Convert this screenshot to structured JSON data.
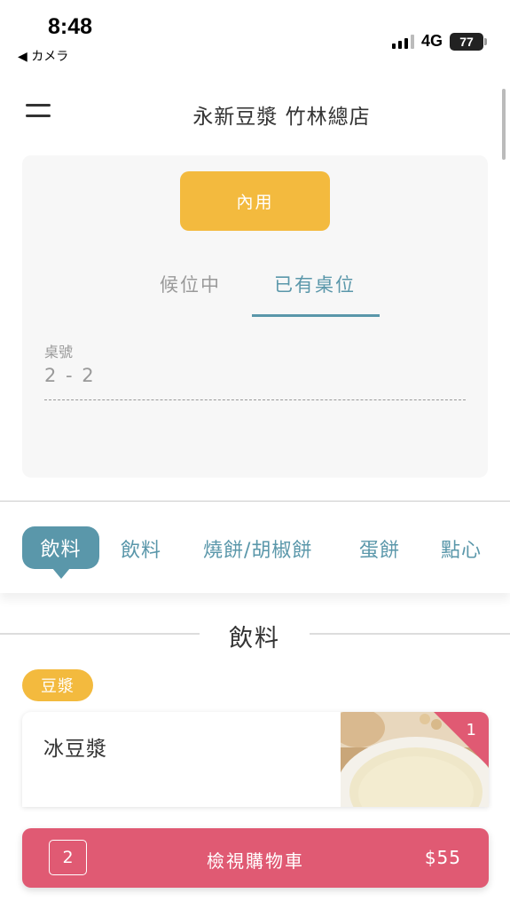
{
  "status_bar": {
    "time": "8:48",
    "back_app": "◀ カメラ",
    "network": "4G",
    "battery": "77"
  },
  "header": {
    "store_title": "永新豆漿 竹林總店"
  },
  "order_mode": {
    "dine_in_label": "內用",
    "tabs": [
      "候位中",
      "已有桌位"
    ],
    "active_tab": "已有桌位",
    "table_label": "桌號",
    "table_value": "2 - 2"
  },
  "categories": {
    "active": "飲料",
    "items": [
      "飲料",
      "燒餅/胡椒餅",
      "蛋餅",
      "點心"
    ]
  },
  "section": {
    "title": "飲料",
    "subcategory": "豆漿"
  },
  "products": [
    {
      "name": "冰豆漿",
      "qty": "1"
    }
  ],
  "cart": {
    "count": "2",
    "label": "檢視購物車",
    "total": "$55"
  },
  "colors": {
    "accent_teal": "#5a97aa",
    "accent_yellow": "#f3ba3e",
    "accent_pink": "#e05a73"
  }
}
